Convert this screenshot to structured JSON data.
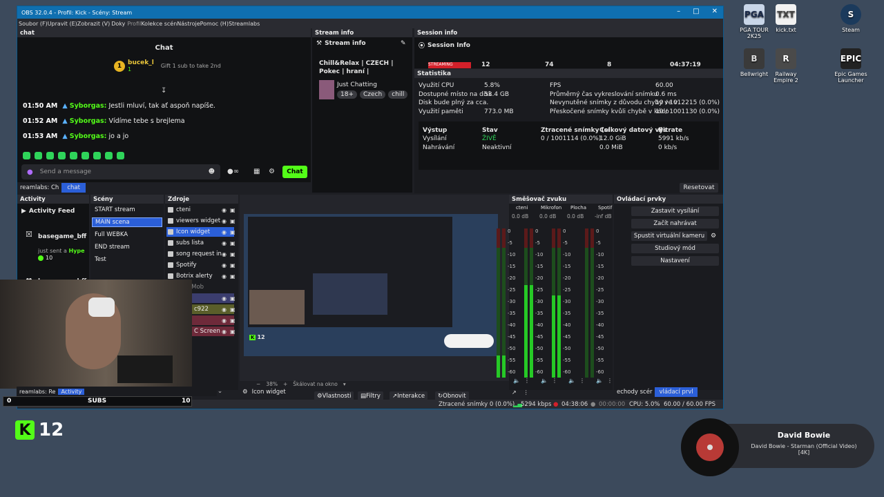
{
  "window": {
    "title": "OBS 32.0.4 - Profil: Kick - Scény: Stream"
  },
  "menu": [
    "Soubor (F)",
    "Upravit (E)",
    "Zobrazit (V)",
    "Doky",
    "Profil",
    "Kolekce scén",
    "Nástroje",
    "Pomoc (H)",
    "Streamlabs"
  ],
  "chat": {
    "dock_title": "chat",
    "header": "Chat",
    "pinned_user": "bucek_l",
    "pinned_count": "1",
    "gift_text": "Gift 1 sub to take 2nd",
    "messages": [
      {
        "time": "01:50 AM",
        "user": "Syborgas:",
        "text": "Jestli mluví, tak ať aspoň napíše."
      },
      {
        "time": "01:52 AM",
        "user": "Syborgas:",
        "text": "Vídíme tebe s brejlema"
      },
      {
        "time": "01:53 AM",
        "user": "Syborgas:",
        "text": "jo a jo"
      }
    ],
    "input_placeholder": "Send a message",
    "send_label": "Chat",
    "tabs": [
      "reamlabs: Ch",
      "chat"
    ]
  },
  "stream_info": {
    "dock_title": "Stream info",
    "header": "Stream info",
    "title": "Chill&Relax | CZECH | Pokec | hraní |",
    "category": "Just Chatting",
    "tags": [
      "18+",
      "Czech",
      "chill"
    ]
  },
  "session_info": {
    "dock_title": "Session info",
    "header": "Session Info",
    "badge": "STREAMING",
    "numbers": [
      "12",
      "74",
      "8",
      "04:37:19"
    ]
  },
  "stats": {
    "title": "Statistika",
    "left": [
      {
        "label": "Využití CPU",
        "value": "5.8%"
      },
      {
        "label": "Dostupné místo na disk",
        "value": "53.4 GB"
      },
      {
        "label": "Disk bude plný za cca.",
        "value": ""
      },
      {
        "label": "Využití paměti",
        "value": "773.0 MB"
      }
    ],
    "right": [
      {
        "label": "FPS",
        "value": "60.00"
      },
      {
        "label": "Průměrný čas vykreslování snímku",
        "value": "0.6 ms"
      },
      {
        "label": "Nevynutěné snímky z důvodu chyby ve v",
        "value": "10 / 1012215 (0.0%)"
      },
      {
        "label": "Přeskočené snímky kvůli chybě v kódo",
        "value": "10 / 1001130 (0.0%)"
      }
    ],
    "table_headers": [
      "Výstup",
      "Stav",
      "Ztracené snímky (sí",
      "Celkový datový výs",
      "Bitrate"
    ],
    "rows": [
      [
        "Vysílání",
        "ŽIVĚ",
        "0 / 1001114 (0.0%)",
        "12.0 GiB",
        "5991 kb/s"
      ],
      [
        "Nahrávání",
        "Neaktivní",
        "",
        "0.0 MiB",
        "0 kb/s"
      ]
    ],
    "reset_label": "Resetovat"
  },
  "activity": {
    "dock_title": "Activity",
    "header": "Activity Feed",
    "items": [
      {
        "user": "basegame_bff",
        "text": "just sent a",
        "highlight": "Hype",
        "amount": "10"
      },
      {
        "user": "basegame_bff",
        "text": "",
        "highlight": "",
        "amount": ""
      }
    ],
    "tabs": [
      "reamlabs: Re",
      "Activity"
    ]
  },
  "scenes": {
    "dock_title": "Scény",
    "items": [
      "START stream",
      "MAIN scena",
      "Full WEBKA",
      "END stream",
      "Test"
    ],
    "selected": "MAIN scena"
  },
  "sources": {
    "dock_title": "Zdroje",
    "items": [
      "cteni",
      "viewers widget",
      "Icon widget",
      "subs lista",
      "song request in",
      "Spotify",
      "Botrix alerty",
      "Cam Mob",
      "",
      "c922",
      "",
      "C Screen"
    ]
  },
  "preview": {
    "zoom": "38%",
    "scale_label": "Škálovat na okno",
    "current_source": "Icon widget",
    "buttons": [
      "Vlastnosti",
      "Filtry",
      "Interakce",
      "Obnovit"
    ]
  },
  "mixer": {
    "dock_title": "Směšovač zvuku",
    "channels": [
      {
        "name": "cteni",
        "db": "0.0 dB",
        "level": 0.15
      },
      {
        "name": "Mikrofon",
        "db": "0.0 dB",
        "level": 0.62
      },
      {
        "name": "Plocha",
        "db": "0.0 dB",
        "level": 0.55
      },
      {
        "name": "Spotif",
        "db": "-inf dB",
        "level": 0.0
      }
    ],
    "scale": [
      "0",
      "-5",
      "-10",
      "-15",
      "-20",
      "-25",
      "-30",
      "-35",
      "-40",
      "-45",
      "-50",
      "-55",
      "-60"
    ]
  },
  "controls": {
    "dock_title": "Ovládací prvky",
    "buttons": [
      "Zastavit vysílání",
      "Začít nahrávat",
      "Spustit virtuální kameru",
      "Studiový mód",
      "Nastavení"
    ],
    "tabs": [
      "echody scér",
      "vládací prvl"
    ]
  },
  "status": {
    "dropped": "Ztracené snímky 0 (0.0%)",
    "bitrate": "5294 kbps",
    "live_time": "04:38:06",
    "rec_time": "00:00:00",
    "cpu": "CPU: 5.0%",
    "fps": "60.00 / 60.00 FPS"
  },
  "subs_bar": {
    "left": "0",
    "label": "SUBS",
    "right": "10"
  },
  "kick_overlay": {
    "count": "12"
  },
  "now_playing": {
    "artist": "David Bowie",
    "track": "David Bowie - Starman (Official Video) [4K]"
  },
  "desktop_icons": [
    {
      "label": "kick.txt"
    },
    {
      "label": "Steam"
    },
    {
      "label": "PGA TOUR 2K25"
    },
    {
      "label": "Bellwright"
    },
    {
      "label": "Railway Empire 2"
    },
    {
      "label": "Epic Games Launcher"
    }
  ],
  "colors": {
    "kick_green": "#53fc18",
    "obs_blue": "#0f6fb0",
    "selected": "#2b5fd8"
  }
}
